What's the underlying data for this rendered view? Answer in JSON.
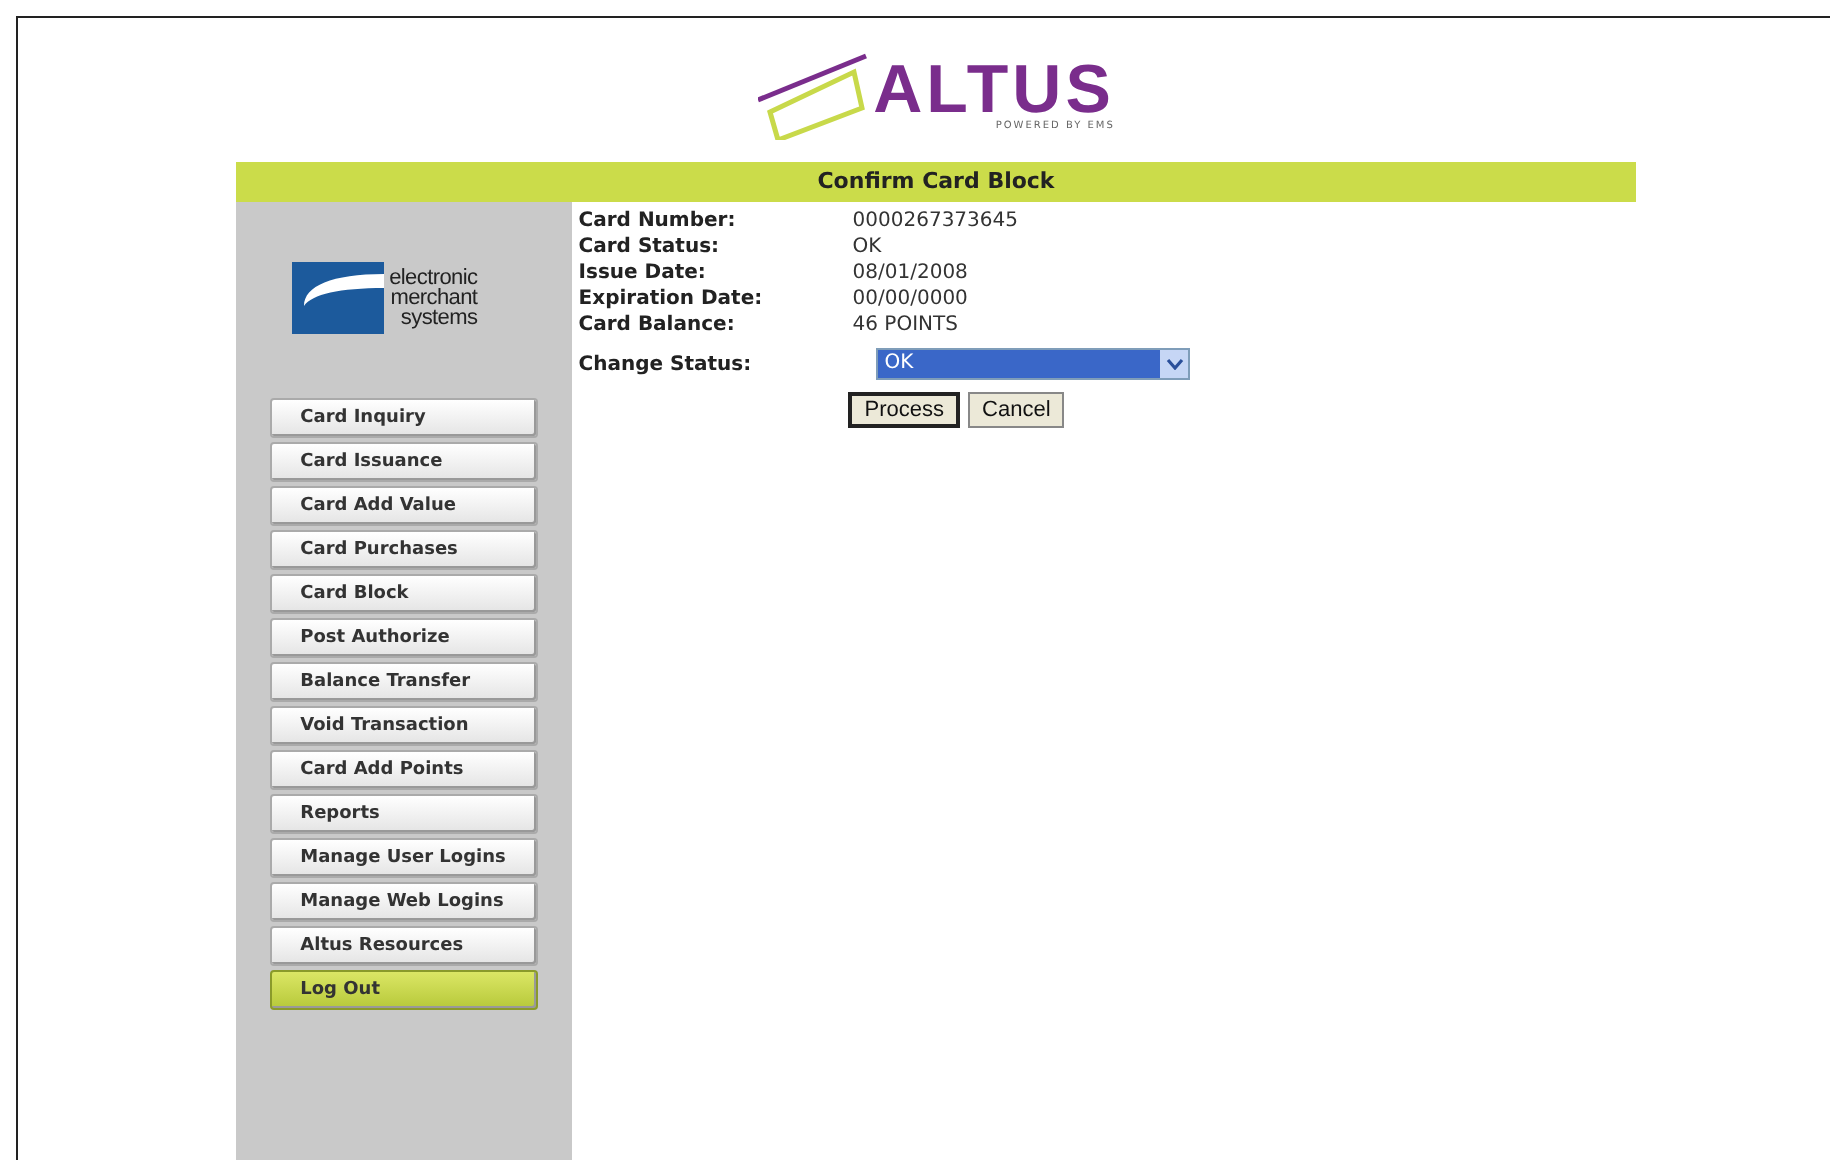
{
  "header": {
    "brand": "ALTUS",
    "tagline": "POWERED BY EMS"
  },
  "title_bar": {
    "title": "Confirm Card Block"
  },
  "sidebar": {
    "company_logo": {
      "lines": [
        "electronic",
        "merchant",
        "systems"
      ]
    },
    "menu": [
      {
        "label": "Card Inquiry",
        "highlighted": false
      },
      {
        "label": "Card Issuance",
        "highlighted": false
      },
      {
        "label": "Card Add Value",
        "highlighted": false
      },
      {
        "label": "Card Purchases",
        "highlighted": false
      },
      {
        "label": "Card Block",
        "highlighted": false
      },
      {
        "label": "Post Authorize",
        "highlighted": false
      },
      {
        "label": "Balance Transfer",
        "highlighted": false
      },
      {
        "label": "Void Transaction",
        "highlighted": false
      },
      {
        "label": "Card Add Points",
        "highlighted": false
      },
      {
        "label": "Reports",
        "highlighted": false
      },
      {
        "label": "Manage User Logins",
        "highlighted": false
      },
      {
        "label": "Manage Web Logins",
        "highlighted": false
      },
      {
        "label": "Altus Resources",
        "highlighted": false
      },
      {
        "label": "Log Out",
        "highlighted": true
      }
    ]
  },
  "details": [
    {
      "label": "Card Number:",
      "value": "0000267373645"
    },
    {
      "label": "Card Status:",
      "value": "OK"
    },
    {
      "label": "Issue Date:",
      "value": "08/01/2008"
    },
    {
      "label": "Expiration Date:",
      "value": "00/00/0000"
    },
    {
      "label": "Card Balance:",
      "value": "46 POINTS"
    }
  ],
  "change_status": {
    "label": "Change Status:",
    "value": "OK"
  },
  "buttons": [
    {
      "label": "Process",
      "focused": true
    },
    {
      "label": "Cancel",
      "focused": false
    }
  ]
}
